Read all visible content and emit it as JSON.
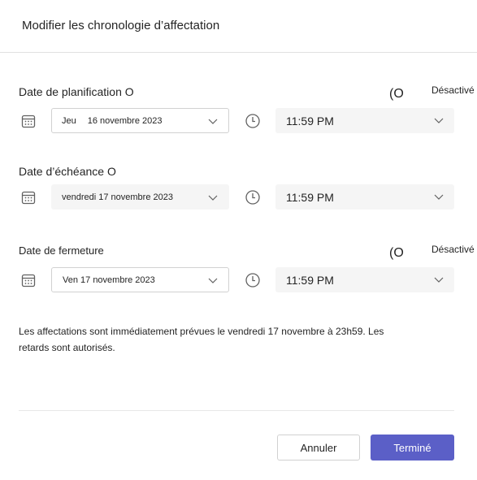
{
  "dialog": {
    "title": "Modifier les chronologie d’affectation"
  },
  "schedule": {
    "label": "Date de planification O",
    "toggle_glyph": "(O",
    "toggle_state": "Désactivé",
    "date_day": "Jeu",
    "date_value": "16 novembre 2023",
    "time_value": "11:59 PM",
    "calendar_icon": "calendar-icon",
    "clock_icon": "clock-icon"
  },
  "due": {
    "label": "Date d’échéance O",
    "date_value": "vendredi 17 novembre 2023",
    "time_value": "11:59 PM",
    "calendar_icon": "calendar-icon",
    "clock_icon": "clock-icon"
  },
  "close": {
    "label": "Date de fermeture",
    "toggle_glyph": "(O",
    "toggle_state": "Désactivé",
    "date_value": "Ven 17 novembre 2023",
    "time_value": "11:59 PM",
    "calendar_icon": "calendar-icon",
    "clock_icon": "clock-icon"
  },
  "info": {
    "text": "Les affectations sont immédiatement prévues le vendredi 17 novembre à 23h59. Les retards sont autorisés."
  },
  "footer": {
    "cancel_label": "Annuler",
    "done_label": "Terminé"
  },
  "colors": {
    "primary": "#5b5fc7",
    "field_fill": "#f5f5f5",
    "border": "#d1d1d1"
  }
}
